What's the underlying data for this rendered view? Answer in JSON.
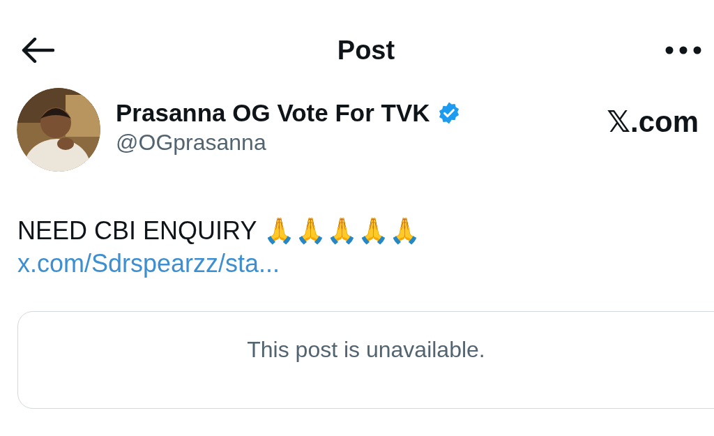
{
  "header": {
    "title": "Post"
  },
  "author": {
    "name": "Prasanna OG Vote For TVK",
    "verified": true,
    "handle": "@OGprasanna"
  },
  "source_label": "𝕏.com",
  "post": {
    "text": "NEED CBI ENQUIRY 🙏🙏🙏🙏🙏",
    "link": "x.com/Sdrspearzz/sta..."
  },
  "quoted_post": {
    "message": "This post is unavailable."
  }
}
